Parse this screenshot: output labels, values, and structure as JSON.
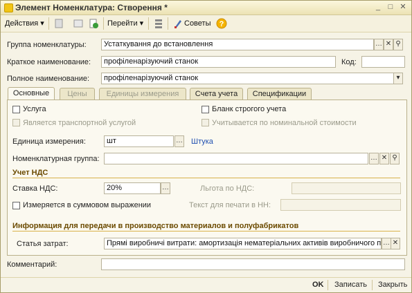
{
  "window": {
    "title": "Элемент Номенклатура: Створення *"
  },
  "toolbar": {
    "actions": "Действия",
    "goto": "Перейти",
    "advice": "Советы"
  },
  "header": {
    "group_label": "Группа номенклатуры:",
    "group_value": "Устаткування до встановлення",
    "short_label": "Краткое наименование:",
    "short_value": "профіленарізуючий станок",
    "code_label": "Код:",
    "code_value": "",
    "full_label": "Полное наименование:",
    "full_value": "профіленарізуючий станок"
  },
  "tabs": [
    {
      "label": "Основные",
      "active": true
    },
    {
      "label": "Цены",
      "disabled": true
    },
    {
      "label": "Единицы измерения",
      "disabled": true
    },
    {
      "label": "Счета учета"
    },
    {
      "label": "Спецификации"
    }
  ],
  "main": {
    "service_label": "Услуга",
    "service_checked": false,
    "transport_label": "Является транспортной услугой",
    "blank_label": "Бланк строгого учета",
    "blank_checked": false,
    "nominal_label": "Учитывается по номинальной стоимости",
    "unit_label": "Единица измерения:",
    "unit_value": "шт",
    "unit_link": "Штука",
    "nomgroup_label": "Номенклатурная группа:",
    "nomgroup_value": "",
    "vat_section": "Учет НДС",
    "vat_rate_label": "Ставка НДС:",
    "vat_rate_value": "20%",
    "vat_benefit_label": "Льгота по НДС:",
    "vat_benefit_value": "",
    "sum_label": "Измеряется в суммовом выражении",
    "sum_checked": false,
    "print_label": "Текст для печати в НН:",
    "print_value": "",
    "prod_section": "Информация для передачи в производство материалов и полуфабрикатов",
    "cost_label": "Статья затрат:",
    "cost_value": "Прямі виробничі витрати: амортизація нематеріальних активів виробничого п"
  },
  "footer": {
    "comment_label": "Комментарий:",
    "comment_value": "",
    "ok": "OK",
    "save": "Записать",
    "close": "Закрыть"
  },
  "colors": {
    "accent_section": "#6b4a00",
    "section_line": "#d8b24a",
    "link": "#1f4fb0",
    "title_bg": "#ece3b4"
  }
}
